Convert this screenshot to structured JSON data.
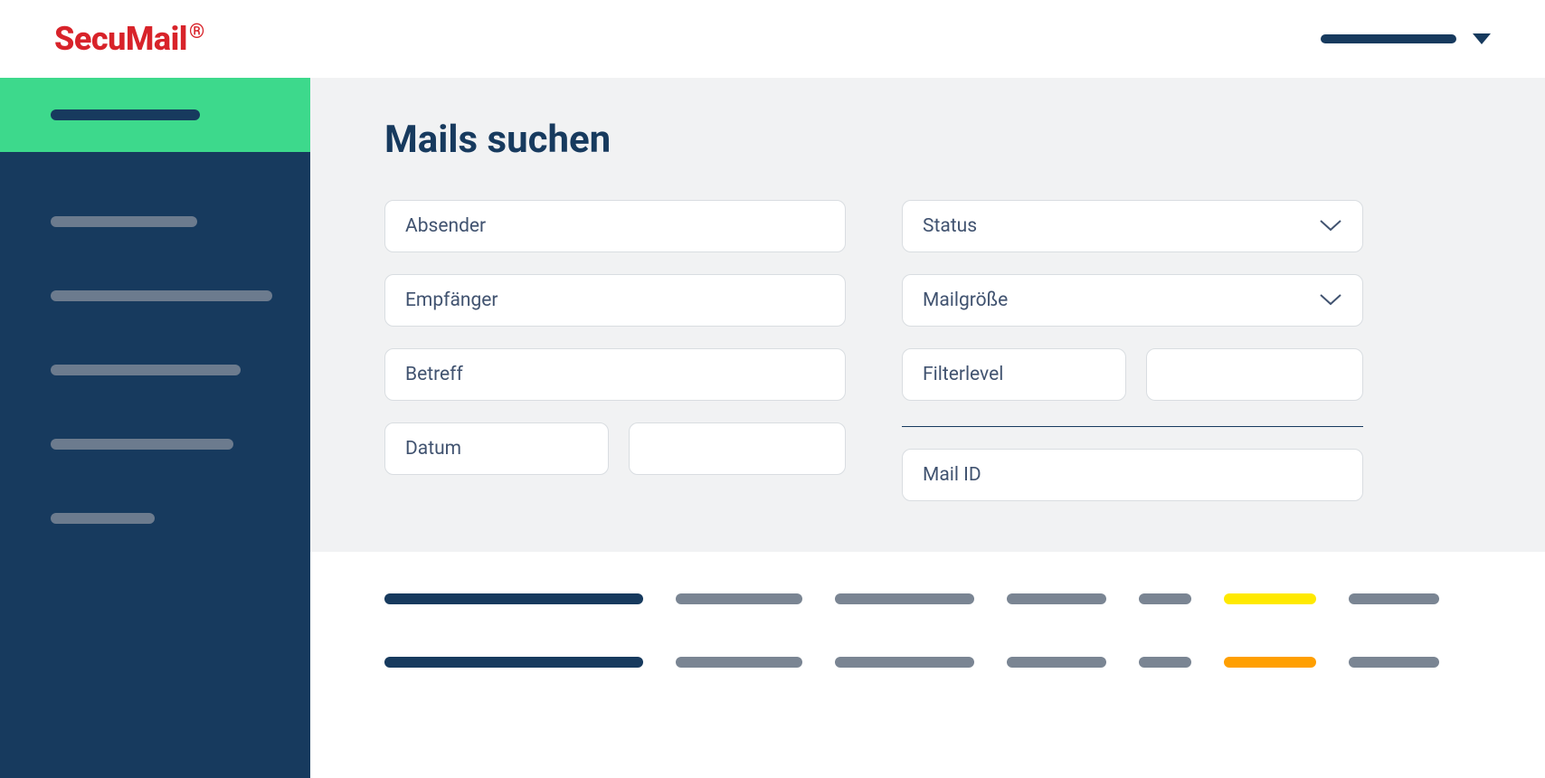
{
  "brand": {
    "name": "SecuMail",
    "mark": "®"
  },
  "header": {
    "title": "Mails suchen"
  },
  "form": {
    "absender": "Absender",
    "empfaenger": "Empfänger",
    "betreff": "Betreff",
    "datum": "Datum",
    "status": "Status",
    "mailgroesse": "Mailgröße",
    "filterlevel": "Filterlevel",
    "mailid": "Mail ID"
  }
}
